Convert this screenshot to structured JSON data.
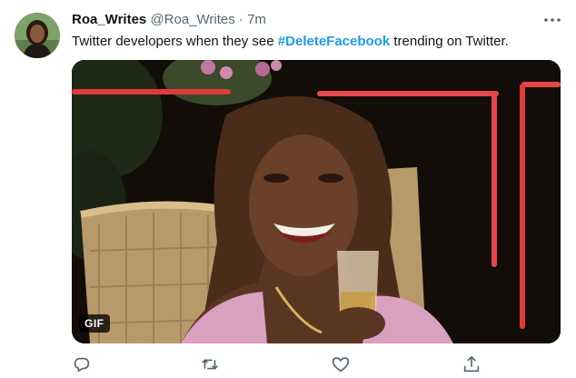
{
  "tweet": {
    "author_name": "Roa_Writes",
    "author_handle": "@Roa_Writes",
    "separator": "·",
    "timestamp": "7m",
    "text_before": "Twitter developers when they see ",
    "hashtag": "#DeleteFacebook",
    "text_after": " trending on Twitter."
  },
  "media": {
    "badge": "GIF"
  },
  "icons": {
    "more": "more-horizontal-icon",
    "reply": "reply-icon",
    "retweet": "retweet-icon",
    "like": "heart-icon",
    "share": "share-icon"
  },
  "colors": {
    "accent": "#1d9bf0",
    "text_primary": "#0f1419",
    "text_secondary": "#536471"
  }
}
